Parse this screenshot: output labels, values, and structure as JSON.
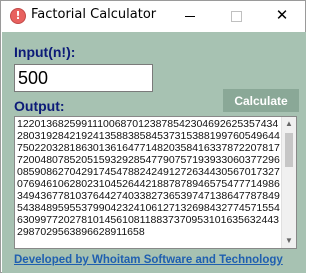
{
  "window": {
    "title": "Factorial Calculator",
    "icon": "exclamation-icon"
  },
  "input": {
    "label": "Input(n!):",
    "value": "500"
  },
  "calculate_button": {
    "label": "Calculate"
  },
  "output": {
    "label": "Output:",
    "text": "1220136825991110068701238785423046926253574342803192842192413588385845373153881997605496447502203281863013616477148203584163378722078177200480785205159329285477907571939330603772960859086270429174547882424912726344305670173270769461062802310452644218878789465754777149863494367781037644274033827365397471386477878495438489595537990423241061271326984327745715546309977202781014561081188373709531016356324432987029563896628911658"
  },
  "footer": {
    "link_text": "Developed by Whoitam Software and Technology"
  },
  "colors": {
    "client_background": "#a7c2b2",
    "label_color": "#0c1b78",
    "button_background": "#8aa897",
    "link_color": "#1f5fb0"
  }
}
